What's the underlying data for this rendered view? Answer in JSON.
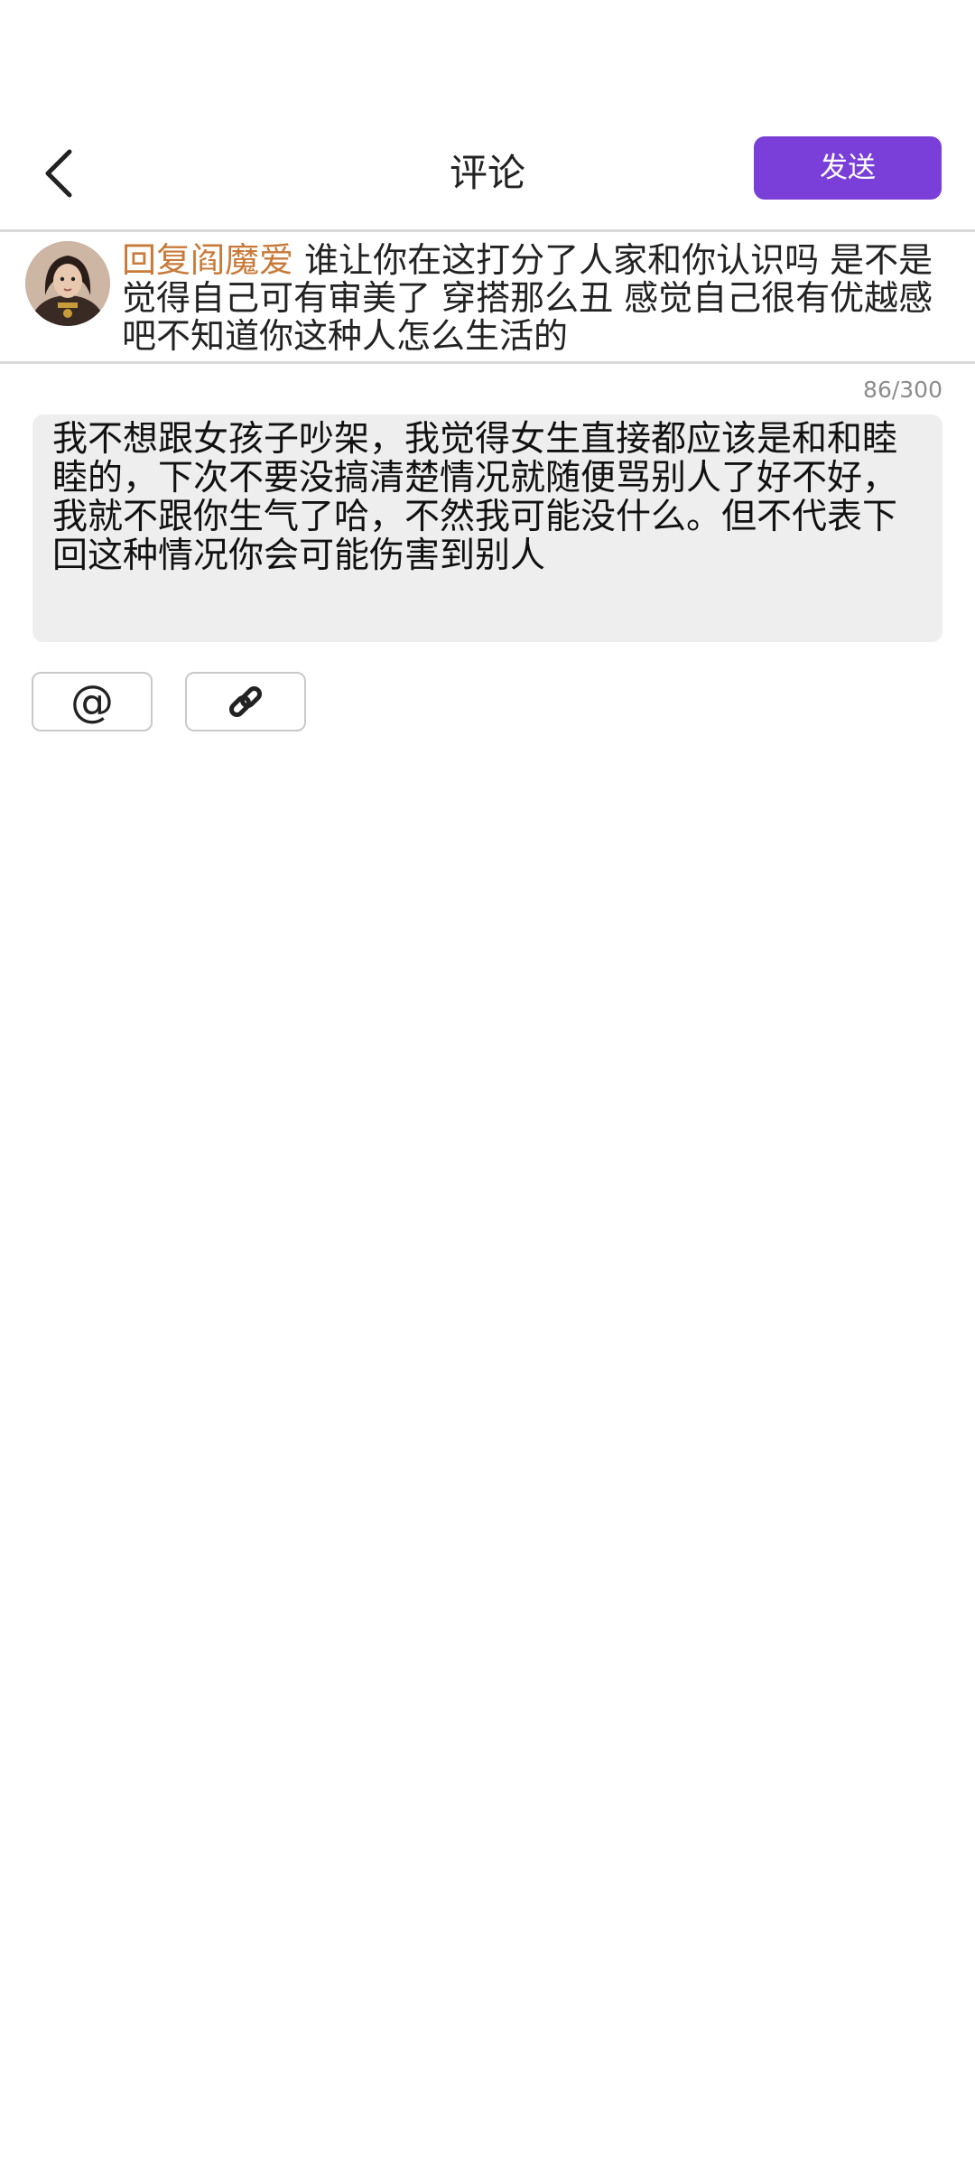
{
  "header": {
    "title": "评论",
    "send_label": "发送"
  },
  "reply": {
    "prefix": "回复阎魔爱",
    "text": " 谁让你在这打分了人家和你认识吗 是不是觉得自己可有审美了 穿搭那么丑 感觉自己很有优越感吧不知道你这种人怎么生活的"
  },
  "comment": {
    "counter": "86/300",
    "text": "我不想跟女孩子吵架，我觉得女生直接都应该是和和睦睦的，下次不要没搞清楚情况就随便骂别人了好不好，我就不跟你生气了哈，不然我可能没什么。但不代表下回这种情况你会可能伤害到别人"
  },
  "toolbar": {
    "mention_symbol": "@",
    "link_icon": "link-icon"
  },
  "colors": {
    "accent": "#7a3fd8",
    "reply_prefix": "#c97a38",
    "input_bg": "#eeeeee"
  }
}
